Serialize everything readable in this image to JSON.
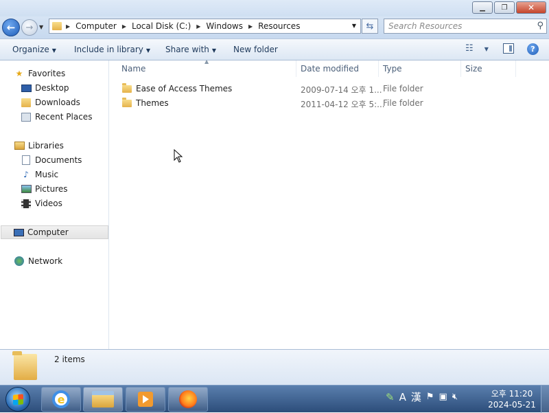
{
  "window": {
    "minimize_glyph": "▁",
    "maximize_glyph": "❐",
    "close_glyph": "✕"
  },
  "address": {
    "segments": [
      "Computer",
      "Local Disk (C:)",
      "Windows",
      "Resources"
    ],
    "refresh_glyph": "⇆",
    "search_placeholder": "Search Resources"
  },
  "toolbar": {
    "organize": "Organize",
    "include_in_library": "Include in library",
    "share_with": "Share with",
    "new_folder": "New folder"
  },
  "nav": {
    "favorites": "Favorites",
    "desktop": "Desktop",
    "downloads": "Downloads",
    "recent_places": "Recent Places",
    "libraries": "Libraries",
    "documents": "Documents",
    "music": "Music",
    "pictures": "Pictures",
    "videos": "Videos",
    "computer": "Computer",
    "network": "Network"
  },
  "columns": {
    "name": "Name",
    "date_modified": "Date modified",
    "type": "Type",
    "size": "Size"
  },
  "files": [
    {
      "name": "Ease of Access Themes",
      "date": "2009-07-14 오후 1...",
      "type": "File folder"
    },
    {
      "name": "Themes",
      "date": "2011-04-12 오후 5:...",
      "type": "File folder"
    }
  ],
  "details": {
    "count": "2 items"
  },
  "taskbar": {
    "ime_a": "A",
    "ime_han": "漢",
    "clock_time": "오후 11:20",
    "clock_date": "2024-05-21"
  }
}
